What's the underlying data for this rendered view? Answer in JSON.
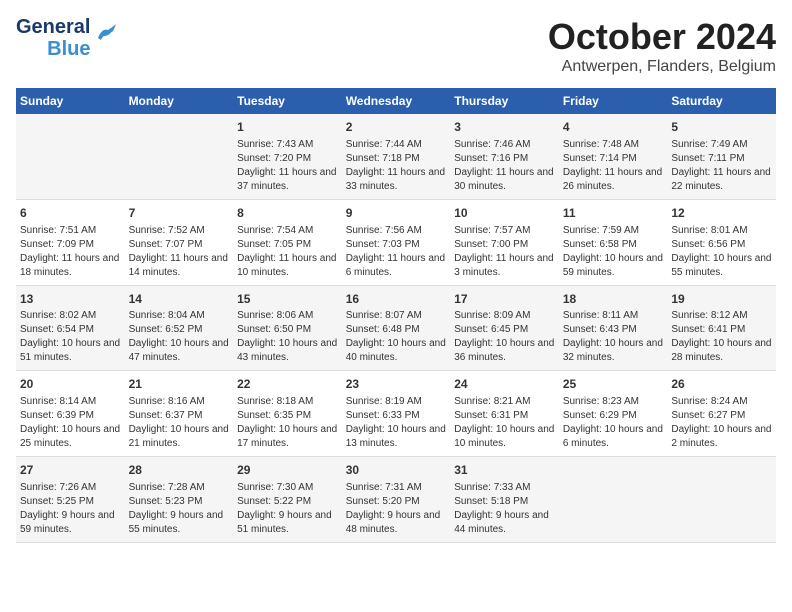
{
  "header": {
    "logo_line1": "General",
    "logo_line2": "Blue",
    "month": "October 2024",
    "location": "Antwerpen, Flanders, Belgium"
  },
  "weekdays": [
    "Sunday",
    "Monday",
    "Tuesday",
    "Wednesday",
    "Thursday",
    "Friday",
    "Saturday"
  ],
  "weeks": [
    [
      {
        "day": "",
        "info": ""
      },
      {
        "day": "",
        "info": ""
      },
      {
        "day": "1",
        "info": "Sunrise: 7:43 AM\nSunset: 7:20 PM\nDaylight: 11 hours and 37 minutes."
      },
      {
        "day": "2",
        "info": "Sunrise: 7:44 AM\nSunset: 7:18 PM\nDaylight: 11 hours and 33 minutes."
      },
      {
        "day": "3",
        "info": "Sunrise: 7:46 AM\nSunset: 7:16 PM\nDaylight: 11 hours and 30 minutes."
      },
      {
        "day": "4",
        "info": "Sunrise: 7:48 AM\nSunset: 7:14 PM\nDaylight: 11 hours and 26 minutes."
      },
      {
        "day": "5",
        "info": "Sunrise: 7:49 AM\nSunset: 7:11 PM\nDaylight: 11 hours and 22 minutes."
      }
    ],
    [
      {
        "day": "6",
        "info": "Sunrise: 7:51 AM\nSunset: 7:09 PM\nDaylight: 11 hours and 18 minutes."
      },
      {
        "day": "7",
        "info": "Sunrise: 7:52 AM\nSunset: 7:07 PM\nDaylight: 11 hours and 14 minutes."
      },
      {
        "day": "8",
        "info": "Sunrise: 7:54 AM\nSunset: 7:05 PM\nDaylight: 11 hours and 10 minutes."
      },
      {
        "day": "9",
        "info": "Sunrise: 7:56 AM\nSunset: 7:03 PM\nDaylight: 11 hours and 6 minutes."
      },
      {
        "day": "10",
        "info": "Sunrise: 7:57 AM\nSunset: 7:00 PM\nDaylight: 11 hours and 3 minutes."
      },
      {
        "day": "11",
        "info": "Sunrise: 7:59 AM\nSunset: 6:58 PM\nDaylight: 10 hours and 59 minutes."
      },
      {
        "day": "12",
        "info": "Sunrise: 8:01 AM\nSunset: 6:56 PM\nDaylight: 10 hours and 55 minutes."
      }
    ],
    [
      {
        "day": "13",
        "info": "Sunrise: 8:02 AM\nSunset: 6:54 PM\nDaylight: 10 hours and 51 minutes."
      },
      {
        "day": "14",
        "info": "Sunrise: 8:04 AM\nSunset: 6:52 PM\nDaylight: 10 hours and 47 minutes."
      },
      {
        "day": "15",
        "info": "Sunrise: 8:06 AM\nSunset: 6:50 PM\nDaylight: 10 hours and 43 minutes."
      },
      {
        "day": "16",
        "info": "Sunrise: 8:07 AM\nSunset: 6:48 PM\nDaylight: 10 hours and 40 minutes."
      },
      {
        "day": "17",
        "info": "Sunrise: 8:09 AM\nSunset: 6:45 PM\nDaylight: 10 hours and 36 minutes."
      },
      {
        "day": "18",
        "info": "Sunrise: 8:11 AM\nSunset: 6:43 PM\nDaylight: 10 hours and 32 minutes."
      },
      {
        "day": "19",
        "info": "Sunrise: 8:12 AM\nSunset: 6:41 PM\nDaylight: 10 hours and 28 minutes."
      }
    ],
    [
      {
        "day": "20",
        "info": "Sunrise: 8:14 AM\nSunset: 6:39 PM\nDaylight: 10 hours and 25 minutes."
      },
      {
        "day": "21",
        "info": "Sunrise: 8:16 AM\nSunset: 6:37 PM\nDaylight: 10 hours and 21 minutes."
      },
      {
        "day": "22",
        "info": "Sunrise: 8:18 AM\nSunset: 6:35 PM\nDaylight: 10 hours and 17 minutes."
      },
      {
        "day": "23",
        "info": "Sunrise: 8:19 AM\nSunset: 6:33 PM\nDaylight: 10 hours and 13 minutes."
      },
      {
        "day": "24",
        "info": "Sunrise: 8:21 AM\nSunset: 6:31 PM\nDaylight: 10 hours and 10 minutes."
      },
      {
        "day": "25",
        "info": "Sunrise: 8:23 AM\nSunset: 6:29 PM\nDaylight: 10 hours and 6 minutes."
      },
      {
        "day": "26",
        "info": "Sunrise: 8:24 AM\nSunset: 6:27 PM\nDaylight: 10 hours and 2 minutes."
      }
    ],
    [
      {
        "day": "27",
        "info": "Sunrise: 7:26 AM\nSunset: 5:25 PM\nDaylight: 9 hours and 59 minutes."
      },
      {
        "day": "28",
        "info": "Sunrise: 7:28 AM\nSunset: 5:23 PM\nDaylight: 9 hours and 55 minutes."
      },
      {
        "day": "29",
        "info": "Sunrise: 7:30 AM\nSunset: 5:22 PM\nDaylight: 9 hours and 51 minutes."
      },
      {
        "day": "30",
        "info": "Sunrise: 7:31 AM\nSunset: 5:20 PM\nDaylight: 9 hours and 48 minutes."
      },
      {
        "day": "31",
        "info": "Sunrise: 7:33 AM\nSunset: 5:18 PM\nDaylight: 9 hours and 44 minutes."
      },
      {
        "day": "",
        "info": ""
      },
      {
        "day": "",
        "info": ""
      }
    ]
  ]
}
